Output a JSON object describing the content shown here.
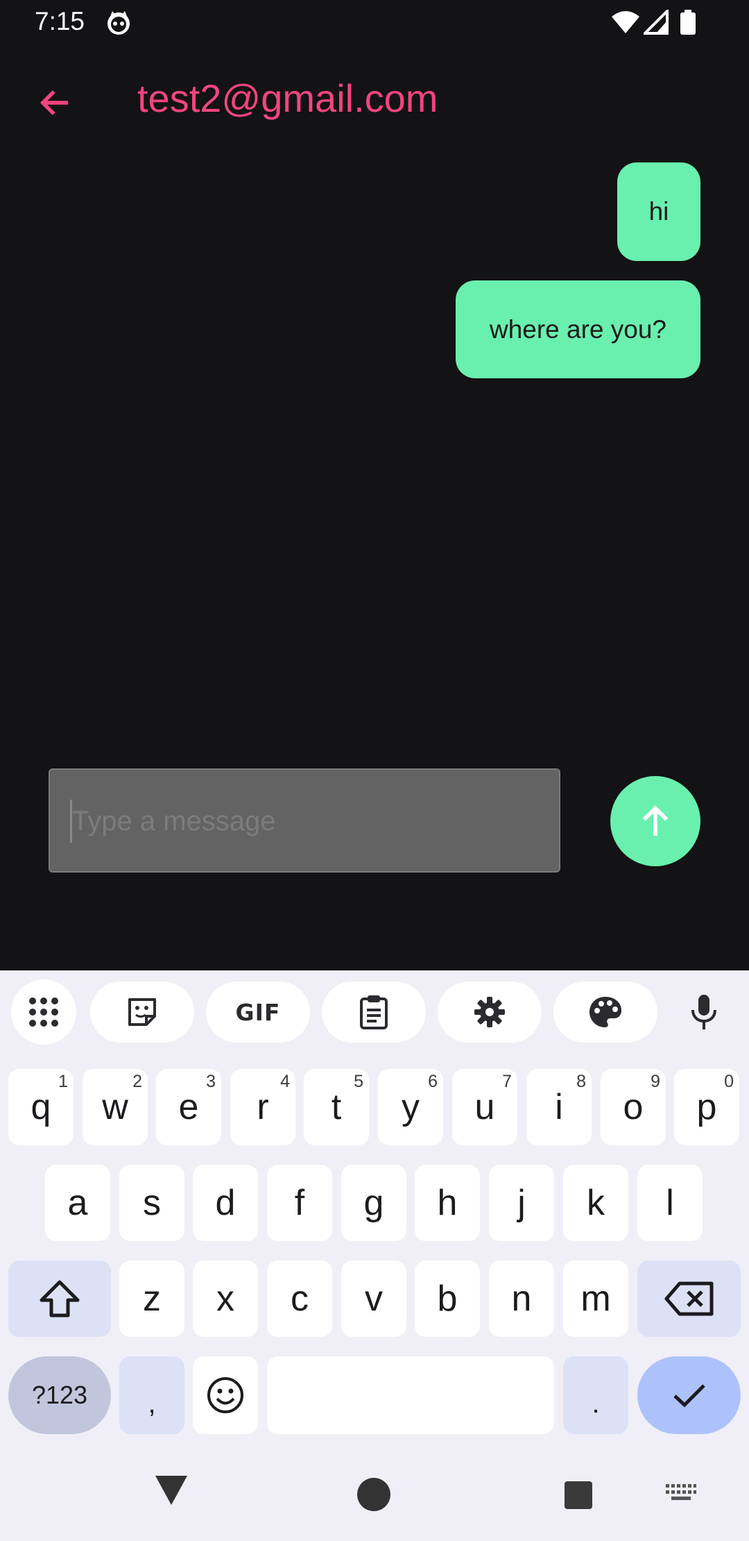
{
  "status_bar": {
    "time": "7:15"
  },
  "app_bar": {
    "title": "test2@gmail.com"
  },
  "messages": [
    {
      "text": "hi",
      "sender": "me"
    },
    {
      "text": "where are you?",
      "sender": "me"
    }
  ],
  "composer": {
    "placeholder": "Type a message",
    "value": ""
  },
  "keyboard": {
    "toolbar": {
      "gif_label": "GIF"
    },
    "row1": [
      {
        "label": "q",
        "hint": "1"
      },
      {
        "label": "w",
        "hint": "2"
      },
      {
        "label": "e",
        "hint": "3"
      },
      {
        "label": "r",
        "hint": "4"
      },
      {
        "label": "t",
        "hint": "5"
      },
      {
        "label": "y",
        "hint": "6"
      },
      {
        "label": "u",
        "hint": "7"
      },
      {
        "label": "i",
        "hint": "8"
      },
      {
        "label": "o",
        "hint": "9"
      },
      {
        "label": "p",
        "hint": "0"
      }
    ],
    "row2": [
      "a",
      "s",
      "d",
      "f",
      "g",
      "h",
      "j",
      "k",
      "l"
    ],
    "row3": [
      "z",
      "x",
      "c",
      "v",
      "b",
      "n",
      "m"
    ],
    "symbols_label": "?123",
    "comma_label": ",",
    "period_label": "."
  },
  "colors": {
    "accent": "#f0457e",
    "bubble": "#69f0ae",
    "background": "#131214",
    "keyboard_bg": "#f0eff7",
    "function_key": "#dde1f6",
    "enter_key": "#adc2fa"
  }
}
